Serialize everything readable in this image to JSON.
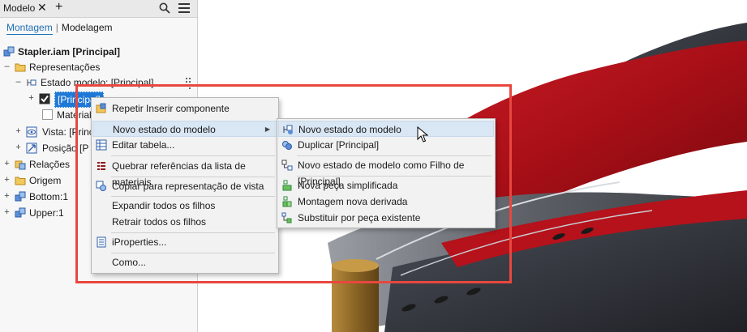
{
  "panel": {
    "title": "Modelo",
    "close_glyph": "✕",
    "add_glyph": "+",
    "icons": {
      "search": "search-icon",
      "menu": "hamburger-menu-icon"
    },
    "modes": {
      "active": "Montagem",
      "separator": "|",
      "other": "Modelagem"
    }
  },
  "tree": {
    "root": "Stapler.iam [Principal]",
    "representacoes": "Representações",
    "estado_modelo": "Estado modelo: [Principal]",
    "principal_selected": "[Principal]",
    "material": "Material",
    "vista": "Vista: [Princi",
    "posicao": "Posição",
    "posicao_suffix": "[P",
    "relacoes": "Relações",
    "origem": "Origem",
    "bottom": "Bottom:1",
    "upper": "Upper:1",
    "expand": "+",
    "collapse": "–"
  },
  "context_menu": {
    "items": [
      {
        "label": "Repetir Inserir componente",
        "icon": "insert-component-icon"
      },
      {
        "label": "Novo estado do modelo",
        "icon": "",
        "has_submenu": true
      },
      {
        "label": "Editar tabela...",
        "icon": "table-icon"
      },
      {
        "label": "Quebrar referências da lista de materiais",
        "icon": "break-bom-icon"
      },
      {
        "label": "Copiar para representação de vista",
        "icon": "copy-view-icon"
      },
      {
        "label": "Expandir todos os filhos",
        "icon": ""
      },
      {
        "label": "Retrair todos os filhos",
        "icon": ""
      },
      {
        "label": "iProperties...",
        "icon": "iproperties-icon"
      },
      {
        "label": "Como...",
        "icon": ""
      }
    ]
  },
  "submenu": {
    "items": [
      {
        "label": "Novo estado do modelo",
        "icon": "new-model-state-icon"
      },
      {
        "label": "Duplicar [Principal]",
        "icon": "duplicate-icon"
      },
      {
        "label": "Novo estado de modelo como Filho de [Principal]",
        "icon": "child-state-icon"
      },
      {
        "label": "Nova peça simplificada",
        "icon": "simplified-part-icon"
      },
      {
        "label": "Montagem nova derivada",
        "icon": "derived-assembly-icon"
      },
      {
        "label": "Substituir por peça existente",
        "icon": "substitute-part-icon"
      }
    ]
  },
  "colors": {
    "accent": "#1e78d6",
    "highlight_frame": "#e8473f",
    "stapler_red": "#b5121b",
    "stapler_dark": "#2e3138",
    "menu_hover": "#d9e6f3"
  }
}
